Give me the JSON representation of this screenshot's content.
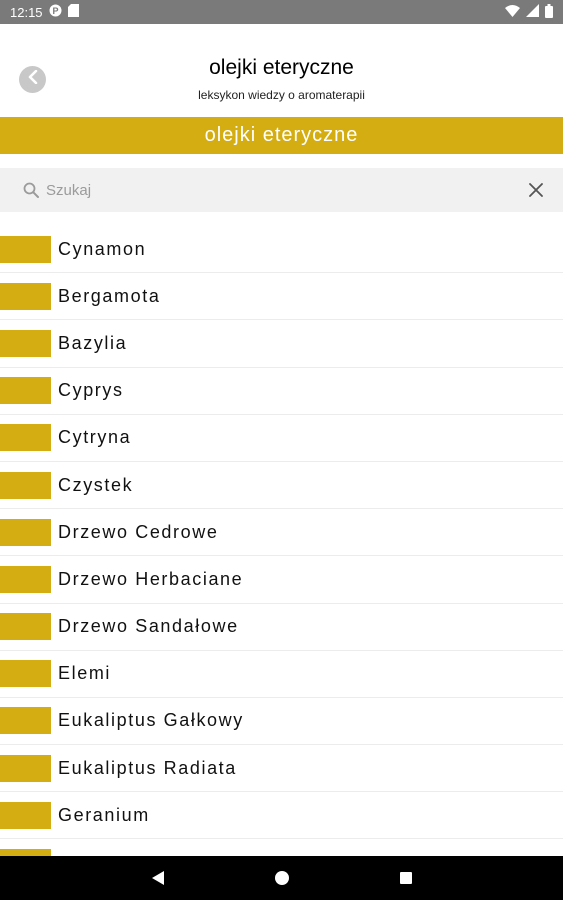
{
  "status_bar": {
    "time": "12:15",
    "icons": [
      "p-notification-icon",
      "sd-card-icon",
      "wifi-icon",
      "signal-icon",
      "battery-icon"
    ]
  },
  "header": {
    "title": "olejki eteryczne",
    "subtitle": "leksykon wiedzy o aromaterapii",
    "back_icon": "chevron-left-icon"
  },
  "banner": {
    "label": "olejki eteryczne"
  },
  "search": {
    "placeholder": "Szukaj",
    "value": "",
    "clear_icon": "close-icon"
  },
  "colors": {
    "accent": "#d3ad11",
    "status_bar": "#7a7a7a",
    "search_bg": "#f1f1f1"
  },
  "items": [
    {
      "label": "Cynamon"
    },
    {
      "label": "Bergamota"
    },
    {
      "label": "Bazylia"
    },
    {
      "label": "Cyprys"
    },
    {
      "label": "Cytryna"
    },
    {
      "label": "Czystek"
    },
    {
      "label": "Drzewo Cedrowe"
    },
    {
      "label": "Drzewo Herbaciane"
    },
    {
      "label": "Drzewo Sandałowe"
    },
    {
      "label": "Elemi"
    },
    {
      "label": "Eukaliptus Gałkowy"
    },
    {
      "label": "Eukaliptus Radiata"
    },
    {
      "label": "Geranium"
    },
    {
      "label": ""
    }
  ],
  "nav_bar": {
    "buttons": [
      "back-triangle-icon",
      "home-circle-icon",
      "recents-square-icon"
    ]
  }
}
